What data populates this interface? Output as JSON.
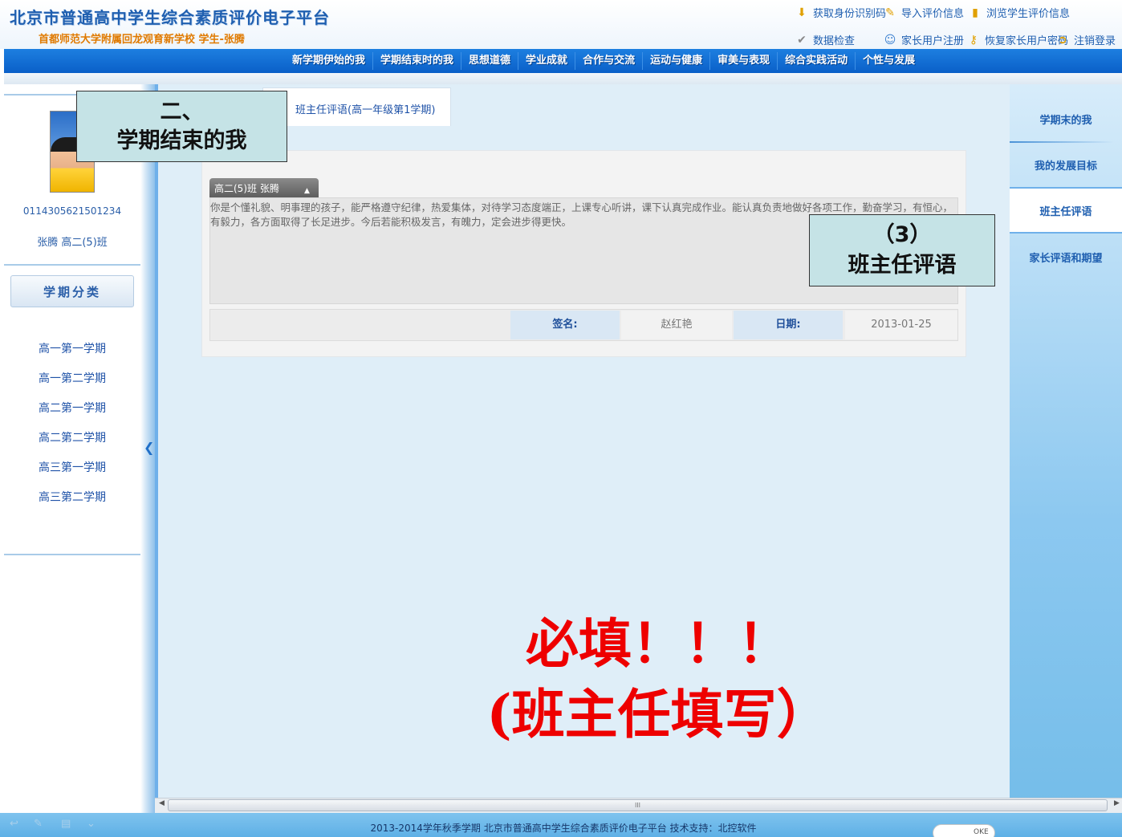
{
  "header": {
    "site_title": "北京市普通高中学生综合素质评价电子平台",
    "school_line": "首都师范大学附属回龙观育新学校  学生-张腾",
    "links_row1": [
      {
        "label": "获取身份识别码",
        "icon": "download-arrow-icon"
      },
      {
        "label": "导入评价信息",
        "icon": "import-icon"
      },
      {
        "label": "浏览学生评价信息",
        "icon": "book-icon"
      }
    ],
    "links_row2": [
      {
        "label": "数据检查",
        "icon": "check-icon"
      },
      {
        "label": "家长用户注册",
        "icon": "user-register-icon"
      },
      {
        "label": "恢复家长用户密码",
        "icon": "key-icon"
      },
      {
        "label": "注销登录",
        "icon": "logout-icon"
      }
    ]
  },
  "nav": {
    "items": [
      "新学期伊始的我",
      "学期结束时的我",
      "思想道德",
      "学业成就",
      "合作与交流",
      "运动与健康",
      "审美与表现",
      "综合实践活动",
      "个性与发展"
    ]
  },
  "student": {
    "id": "0114305621501234",
    "name_class": "张腾 高二(5)班"
  },
  "term_panel": {
    "header": "学期分类",
    "terms": [
      "高一第一学期",
      "高一第二学期",
      "高二第一学期",
      "高二第二学期",
      "高三第一学期",
      "高三第二学期"
    ]
  },
  "main": {
    "tab_title": "班主任评语(高一年级第1学期)",
    "card_tab": "高二(5)班  张腾",
    "comment": "你是个懂礼貌、明事理的孩子，能严格遵守纪律，热爱集体，对待学习态度端正，上课专心听讲，课下认真完成作业。能认真负责地做好各项工作，勤奋学习，有恒心，有毅力，各方面取得了长足进步。今后若能积极发言，有魄力，定会进步得更快。",
    "sign_label": "签名:",
    "sign_value": "赵红艳",
    "date_label": "日期:",
    "date_value": "2013-01-25"
  },
  "right_nav": {
    "items": [
      "学期末的我",
      "我的发展目标",
      "班主任评语",
      "家长评语和期望"
    ],
    "active_index": 2
  },
  "footer": {
    "text": "2013-2014学年秋季学期  北京市普通高中学生综合素质评价电子平台  技术支持：北控软件",
    "toggle_label": "OKE"
  },
  "scrollbar": {
    "grip": "III"
  },
  "callouts": {
    "section_line1": "二、",
    "section_line2": "学期结束的我",
    "item_line1": "（3）",
    "item_line2": "班主任评语"
  },
  "notice": {
    "line1": "必填！！！",
    "line2": "(班主任填写）"
  },
  "colors": {
    "nav_blue": "#0a5fc8",
    "notice_red": "#ee0000",
    "callout_bg": "#c5e3e6",
    "link_blue": "#1f5fb0"
  }
}
